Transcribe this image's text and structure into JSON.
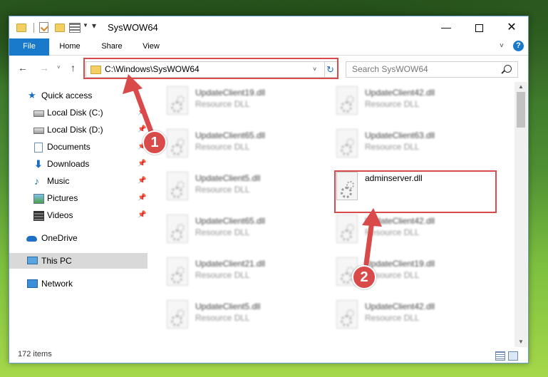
{
  "window": {
    "title": "SysWOW64",
    "min_glyph": "—",
    "close_glyph": "✕"
  },
  "ribbon": {
    "tabs": [
      {
        "label": "File"
      },
      {
        "label": "Home"
      },
      {
        "label": "Share"
      },
      {
        "label": "View"
      }
    ],
    "help_glyph": "?"
  },
  "nav": {
    "back_glyph": "←",
    "forward_glyph": "→",
    "recent_glyph": "˅",
    "up_glyph": "↑"
  },
  "address": {
    "path": "C:\\Windows\\SysWOW64",
    "refresh_glyph": "↻"
  },
  "search": {
    "placeholder": "Search SysWOW64"
  },
  "sidebar": {
    "items": [
      {
        "label": "Quick access"
      },
      {
        "label": "Local Disk (C:)"
      },
      {
        "label": "Local Disk (D:)"
      },
      {
        "label": "Documents"
      },
      {
        "label": "Downloads"
      },
      {
        "label": "Music"
      },
      {
        "label": "Pictures"
      },
      {
        "label": "Videos"
      },
      {
        "label": "OneDrive"
      },
      {
        "label": "This PC"
      },
      {
        "label": "Network"
      }
    ]
  },
  "files": [
    {
      "name": "UpdateClient19.dll",
      "type": "Resource DLL"
    },
    {
      "name": "UpdateClient42.dll",
      "type": "Resource DLL"
    },
    {
      "name": "UpdateClient65.dll",
      "type": "Resource DLL"
    },
    {
      "name": "UpdateClient63.dll",
      "type": "Resource DLL"
    },
    {
      "name": "UpdateClient5.dll",
      "type": "Resource DLL"
    },
    {
      "name": "adminserver.dll",
      "type": ""
    },
    {
      "name": "UpdateClient65.dll",
      "type": "Resource DLL"
    },
    {
      "name": "UpdateClient42.dll",
      "type": "Resource DLL"
    },
    {
      "name": "UpdateClient21.dll",
      "type": "Resource DLL"
    },
    {
      "name": "UpdateClient19.dll",
      "type": "Resource DLL"
    },
    {
      "name": "UpdateClient5.dll",
      "type": "Resource DLL"
    },
    {
      "name": "UpdateClient42.dll",
      "type": "Resource DLL"
    }
  ],
  "status": {
    "items_count": "172 items"
  },
  "callouts": [
    "1",
    "2"
  ],
  "colors": {
    "accent": "#1979ca",
    "highlight": "#d94a4a"
  }
}
